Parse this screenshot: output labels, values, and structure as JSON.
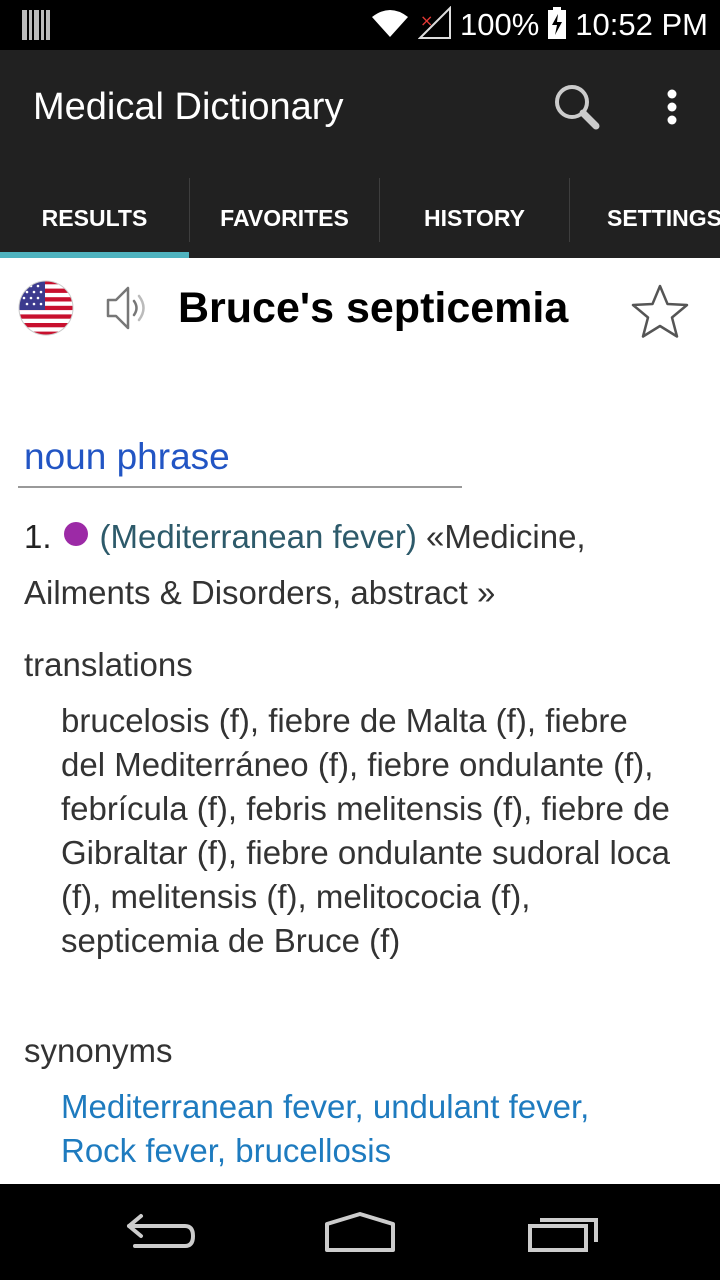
{
  "status_bar": {
    "battery": "100%",
    "time": "10:52 PM",
    "icons": [
      "barcode-icon",
      "wifi-icon",
      "no-signal-icon",
      "battery-charging-icon"
    ]
  },
  "action_bar": {
    "title": "Medical Dictionary",
    "icons": [
      "search-icon",
      "overflow-menu-icon"
    ]
  },
  "tabs": [
    {
      "label": "RESULTS",
      "selected": true
    },
    {
      "label": "FAVORITES",
      "selected": false
    },
    {
      "label": "HISTORY",
      "selected": false
    },
    {
      "label": "SETTINGS",
      "selected": false
    }
  ],
  "entry": {
    "headword": "Bruce's septicemia",
    "language_icon": "us-flag-icon",
    "pronounce_icon": "speaker-icon",
    "favorite_icon": "star-outline-icon",
    "part_of_speech": "noun phrase",
    "sense": {
      "number": "1.",
      "synonym_gloss": "(Mediterranean fever)",
      "context": "«Medicine, Ailments & Disorders, abstract »",
      "dot_color": "#9c2aa6"
    },
    "translations_label": "translations",
    "translations": "brucelosis (f), fiebre de Malta (f), fiebre del Mediterráneo (f), fiebre ondulante (f), febrícula (f), febris melitensis (f), fiebre de Gibraltar (f), fiebre ondulante sudoral loca (f), melitensis (f), melitococia (f), septicemia de Bruce (f)",
    "synonyms_label": "synonyms",
    "synonyms": "Mediterranean fever, undulant fever, Rock fever, brucellosis"
  },
  "nav_bar": {
    "icons": [
      "back-icon",
      "home-icon",
      "recent-apps-icon"
    ]
  },
  "colors": {
    "tab_indicator": "#4fb3bf",
    "pos_text": "#2255c4",
    "link_text": "#1e7bbf"
  }
}
